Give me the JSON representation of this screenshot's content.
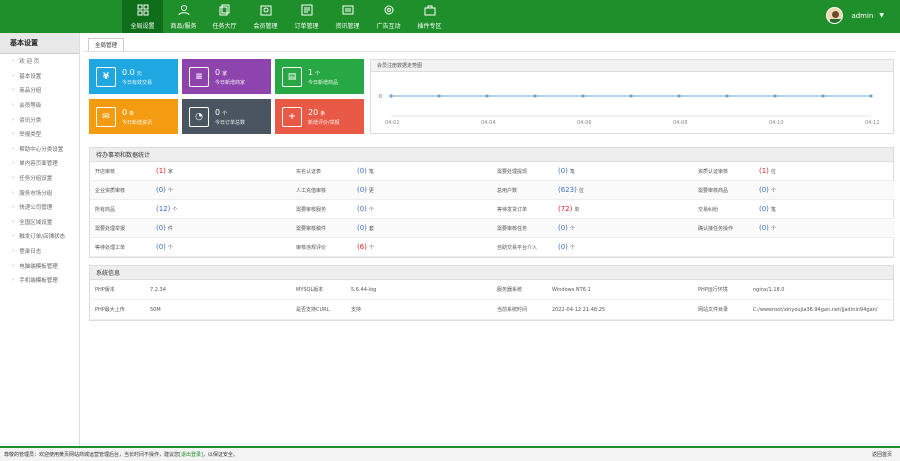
{
  "nav": {
    "items": [
      {
        "label": "全局设置",
        "icon": "grid-icon"
      },
      {
        "label": "商品/服务",
        "icon": "user-icon"
      },
      {
        "label": "任务大厅",
        "icon": "copy-icon"
      },
      {
        "label": "会员管理",
        "icon": "member-icon"
      },
      {
        "label": "订单管理",
        "icon": "order-icon"
      },
      {
        "label": "资讯管理",
        "icon": "news-icon"
      },
      {
        "label": "广告互动",
        "icon": "gear-icon"
      },
      {
        "label": "插件专区",
        "icon": "plugin-icon"
      }
    ]
  },
  "user": {
    "name": "admin"
  },
  "sidebar": {
    "title": "基本设置",
    "items": [
      "欢 迎 页",
      "基本设置",
      "商品分组",
      "会员等级",
      "资讯分类",
      "举报类型",
      "帮助中心分类设置",
      "单内容页面管理",
      "任务分组设置",
      "服务市场分组",
      "快递公司管理",
      "全国区域设置",
      "触发订单/店铺状态",
      "登录日志",
      "电脑端模板管理",
      "手机端模板管理"
    ]
  },
  "tab": {
    "label": "全局管理"
  },
  "tiles": [
    {
      "value": "0.0",
      "unit": "元",
      "label": "今日有效交易",
      "color": "#1ea7e1",
      "icon": "yen-icon"
    },
    {
      "value": "0",
      "unit": "家",
      "label": "今日新增商家",
      "color": "#8e44ad",
      "icon": "list-icon"
    },
    {
      "value": "1",
      "unit": "个",
      "label": "今日新增商品",
      "color": "#27a844",
      "icon": "store-icon"
    },
    {
      "value": "0",
      "unit": "条",
      "label": "今日新增资讯",
      "color": "#f39c12",
      "icon": "mail-icon"
    },
    {
      "value": "0",
      "unit": "个",
      "label": "今日订单总数",
      "color": "#4a5561",
      "icon": "users-icon"
    },
    {
      "value": "20",
      "unit": "条",
      "label": "新增评价/举报",
      "color": "#e95a46",
      "icon": "plus-icon"
    }
  ],
  "chart": {
    "title": "会员注册数据走势图",
    "y_tick": "0"
  },
  "chart_data": {
    "type": "line",
    "title": "会员注册数据走势图",
    "x": [
      "04-02",
      "04-03",
      "04-04",
      "04-05",
      "04-06",
      "04-07",
      "04-08",
      "04-09",
      "04-10",
      "04-11",
      "04-12"
    ],
    "x_tick_labels": [
      "04-02",
      "04-04",
      "04-06",
      "04-08",
      "04-10",
      "04-12"
    ],
    "series": [
      {
        "values": [
          0,
          0,
          0,
          0,
          0,
          0,
          0,
          0,
          0,
          0,
          0
        ]
      }
    ],
    "ylim": [
      0,
      1
    ],
    "grid": false,
    "color": "#6fa8dc"
  },
  "todo": {
    "title": "待办事项和数据统计",
    "rows": [
      [
        {
          "k": "开店审核",
          "v": "(1)",
          "u": "家",
          "c": "red"
        },
        {
          "k": "实名认证表",
          "v": "(0)",
          "u": "笔",
          "c": "blue"
        },
        {
          "k": "需要处理提现",
          "v": "(0)",
          "u": "笔",
          "c": "blue"
        },
        {
          "k": "资质认证审核",
          "v": "(1)",
          "u": "位",
          "c": "red"
        }
      ],
      [
        {
          "k": "企业资质审核",
          "v": "(0)",
          "u": "个",
          "c": "blue"
        },
        {
          "k": "人工充值审核",
          "v": "(0)",
          "u": "更",
          "c": "blue"
        },
        {
          "k": "总用户数",
          "v": "(623)",
          "u": "位",
          "c": "blue"
        },
        {
          "k": "需要审核商品",
          "v": "(0)",
          "u": "个",
          "c": "blue"
        }
      ],
      [
        {
          "k": "所有商品",
          "v": "(12)",
          "u": "个",
          "c": "blue"
        },
        {
          "k": "需要审核服务",
          "v": "(0)",
          "u": "个",
          "c": "blue"
        },
        {
          "k": "等待发货订单",
          "v": "(72)",
          "u": "单",
          "c": "red"
        },
        {
          "k": "交易纠纷",
          "v": "(0)",
          "u": "笔",
          "c": "blue"
        }
      ],
      [
        {
          "k": "需要处理举报",
          "v": "(0)",
          "u": "件",
          "c": "blue"
        },
        {
          "k": "需要审核稿件",
          "v": "(0)",
          "u": "套",
          "c": "blue"
        },
        {
          "k": "需要审核任务",
          "v": "(0)",
          "u": "个",
          "c": "blue"
        },
        {
          "k": "确认接任务操作",
          "v": "(0)",
          "u": "个",
          "c": "blue"
        }
      ],
      [
        {
          "k": "等待处理工单",
          "v": "(0)",
          "u": "个",
          "c": "blue"
        },
        {
          "k": "审核违规评价",
          "v": "(6)",
          "u": "个",
          "c": "red"
        },
        {
          "k": "自助交易平台介入",
          "v": "(0)",
          "u": "个",
          "c": "blue"
        },
        {
          "k": "",
          "v": "",
          "u": "",
          "c": "blue"
        }
      ]
    ]
  },
  "sysinfo": {
    "title": "系统信息",
    "rows": [
      [
        {
          "k": "PHP版本",
          "v": "7.2.34"
        },
        {
          "k": "MYSQL版本",
          "v": "5.6.44-log"
        },
        {
          "k": "服务器系统",
          "v": "Windows NT6.1"
        },
        {
          "k": "PHP运行环境",
          "v": "nginx/1.18.0"
        }
      ],
      [
        {
          "k": "PHP最大上传",
          "v": "50M"
        },
        {
          "k": "是否支持CURL",
          "v": "支持"
        },
        {
          "k": "当前系统时间",
          "v": "2022-04-12 21:48:25"
        },
        {
          "k": "网站文件目录",
          "v": "C:/wwwroot/xinyoujia36.94gan.net/jjadmin94gan/"
        }
      ]
    ]
  },
  "footer": {
    "prefix": "尊敬的管理员：欢迎使用黄页网站商城运营管理后台，当长时间不操作，建议您",
    "link": "[退出登录]",
    "suffix": "，以保证安全。",
    "right": "返回首页"
  }
}
